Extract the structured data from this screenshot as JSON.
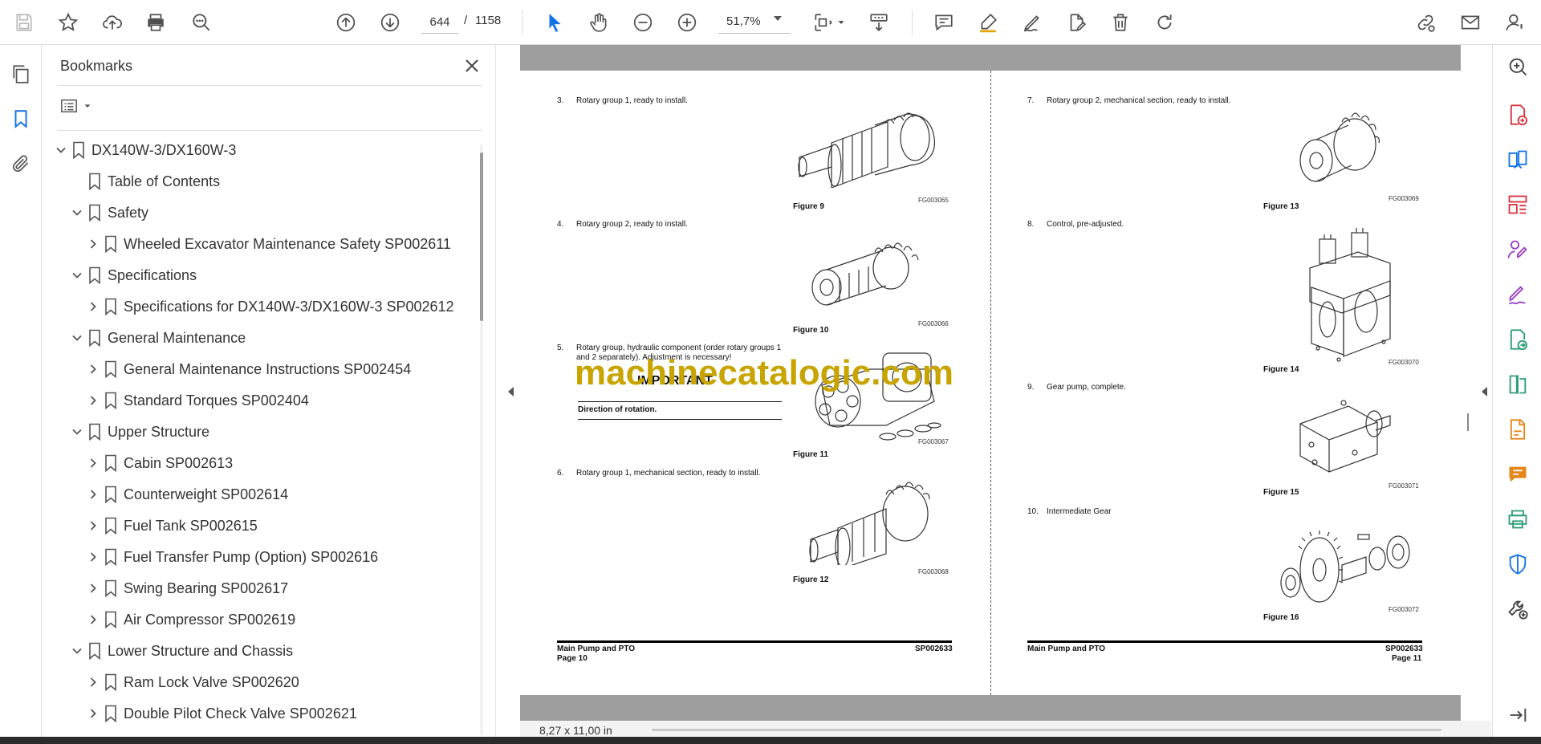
{
  "toolbar": {
    "icons": [
      "save-icon",
      "star-icon",
      "upload-icon",
      "print-icon",
      "zoom-search-icon",
      "page-up-icon",
      "page-down-icon",
      "select-arrow-icon",
      "hand-icon",
      "zoom-out-icon",
      "zoom-in-icon",
      "fit-page-icon",
      "scroll-mode-icon",
      "comment-icon",
      "highlight-icon",
      "sign-icon",
      "edit-icon",
      "delete-icon",
      "rotate-icon",
      "share-link-icon",
      "mail-icon",
      "account-icon"
    ],
    "current_page": "644",
    "page_separator": "/",
    "total_pages": "1158",
    "zoom": "51,7%"
  },
  "bookmarks": {
    "title": "Bookmarks",
    "items": [
      {
        "label": "DX140W-3/DX160W-3",
        "level": 0,
        "state": "expanded"
      },
      {
        "label": "Table of Contents",
        "level": 1,
        "state": "leaf"
      },
      {
        "label": "Safety",
        "level": 1,
        "state": "expanded"
      },
      {
        "label": "Wheeled Excavator Maintenance Safety SP002611",
        "level": 2,
        "state": "collapsed"
      },
      {
        "label": "Specifications",
        "level": 1,
        "state": "expanded"
      },
      {
        "label": "Specifications for DX140W-3/DX160W-3 SP002612",
        "level": 2,
        "state": "collapsed"
      },
      {
        "label": "General Maintenance",
        "level": 1,
        "state": "expanded"
      },
      {
        "label": "General Maintenance Instructions SP002454",
        "level": 2,
        "state": "collapsed"
      },
      {
        "label": "Standard Torques SP002404",
        "level": 2,
        "state": "collapsed"
      },
      {
        "label": "Upper Structure",
        "level": 1,
        "state": "expanded"
      },
      {
        "label": "Cabin SP002613",
        "level": 2,
        "state": "collapsed"
      },
      {
        "label": "Counterweight SP002614",
        "level": 2,
        "state": "collapsed"
      },
      {
        "label": "Fuel Tank SP002615",
        "level": 2,
        "state": "collapsed"
      },
      {
        "label": "Fuel Transfer Pump (Option) SP002616",
        "level": 2,
        "state": "collapsed"
      },
      {
        "label": "Swing Bearing SP002617",
        "level": 2,
        "state": "collapsed"
      },
      {
        "label": "Air Compressor SP002619",
        "level": 2,
        "state": "collapsed"
      },
      {
        "label": "Lower Structure and Chassis",
        "level": 1,
        "state": "expanded"
      },
      {
        "label": "Ram Lock Valve SP002620",
        "level": 2,
        "state": "collapsed"
      },
      {
        "label": "Double Pilot Check Valve SP002621",
        "level": 2,
        "state": "collapsed"
      }
    ]
  },
  "document": {
    "left_page": {
      "steps": [
        {
          "num": "3.",
          "text": "Rotary group 1, ready to install.",
          "figure": "Figure 9",
          "code": "FG003065"
        },
        {
          "num": "4.",
          "text": "Rotary group 2, ready to install.",
          "figure": "Figure 10",
          "code": "FG003066"
        },
        {
          "num": "5.",
          "text": "Rotary group, hydraulic component (order rotary groups 1 and 2 separately). Adjustment is necessary!",
          "figure": "Figure 11",
          "code": "FG003067"
        },
        {
          "num": "6.",
          "text": "Rotary group 1, mechanical section, ready to install.",
          "figure": "Figure 12",
          "code": "FG003068"
        }
      ],
      "important_heading": "IMPORTANT",
      "important_text": "Direction of rotation.",
      "footer_title": "Main Pump and PTO",
      "footer_page": "Page 10",
      "footer_code": "SP002633"
    },
    "right_page": {
      "steps": [
        {
          "num": "7.",
          "text": "Rotary group 2, mechanical section, ready to install.",
          "figure": "Figure 13",
          "code": "FG003069"
        },
        {
          "num": "8.",
          "text": "Control, pre-adjusted.",
          "figure": "Figure 14",
          "code": "FG003070"
        },
        {
          "num": "9.",
          "text": "Gear pump, complete.",
          "figure": "Figure 15",
          "code": "FG003071"
        },
        {
          "num": "10.",
          "text": "Intermediate Gear",
          "figure": "Figure 16",
          "code": "FG003072"
        }
      ],
      "footer_title": "Main Pump and PTO",
      "footer_page": "Page 11",
      "footer_code": "SP002633"
    },
    "watermark": "machinecatalogic.com",
    "page_size": "8,27 x 11,00 in"
  },
  "colors": {
    "accent": "#1473e6",
    "watermark": "#c8a400",
    "tool_pink": "#d7373f",
    "tool_blue": "#1473e6",
    "tool_purple": "#9b3fc7",
    "tool_green": "#2d9d78",
    "tool_yellow": "#e68619"
  }
}
